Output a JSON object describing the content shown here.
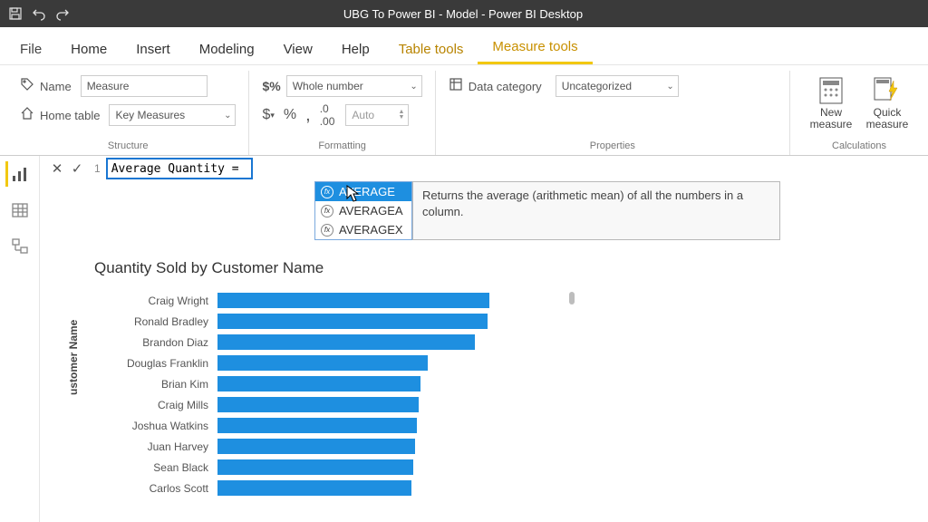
{
  "titlebar": {
    "title": "UBG To Power BI - Model - Power BI Desktop"
  },
  "tabs": {
    "file": "File",
    "items": [
      "Home",
      "Insert",
      "Modeling",
      "View",
      "Help"
    ],
    "contextual": [
      "Table tools",
      "Measure tools"
    ],
    "active": "Measure tools"
  },
  "ribbon": {
    "structure": {
      "name_label": "Name",
      "name_value": "Measure",
      "home_table_label": "Home table",
      "home_table_value": "Key Measures",
      "caption": "Structure"
    },
    "formatting": {
      "format_value": "Whole number",
      "auto_value": "Auto",
      "caption": "Formatting"
    },
    "properties": {
      "data_category_label": "Data category",
      "data_category_value": "Uncategorized",
      "caption": "Properties"
    },
    "calculations": {
      "new_measure": "New measure",
      "quick_measure": "Quick measure",
      "caption": "Calculations"
    }
  },
  "formula": {
    "line": "1",
    "text": "Average Quantity = ",
    "autocomplete": {
      "items": [
        "AVERAGE",
        "AVERAGEA",
        "AVERAGEX"
      ],
      "highlighted": 0,
      "description": "Returns the average (arithmetic mean) of all the numbers in a column."
    }
  },
  "chart_data": {
    "type": "bar",
    "title": "Quantity Sold by Customer Name",
    "ylabel": "ustomer Name",
    "categories": [
      "Craig Wright",
      "Ronald Bradley",
      "Brandon Diaz",
      "Douglas Franklin",
      "Brian Kim",
      "Craig Mills",
      "Joshua Watkins",
      "Juan Harvey",
      "Sean Black",
      "Carlos Scott"
    ],
    "values": [
      300,
      298,
      284,
      232,
      224,
      222,
      220,
      218,
      216,
      214
    ],
    "xlim": [
      0,
      300
    ]
  }
}
